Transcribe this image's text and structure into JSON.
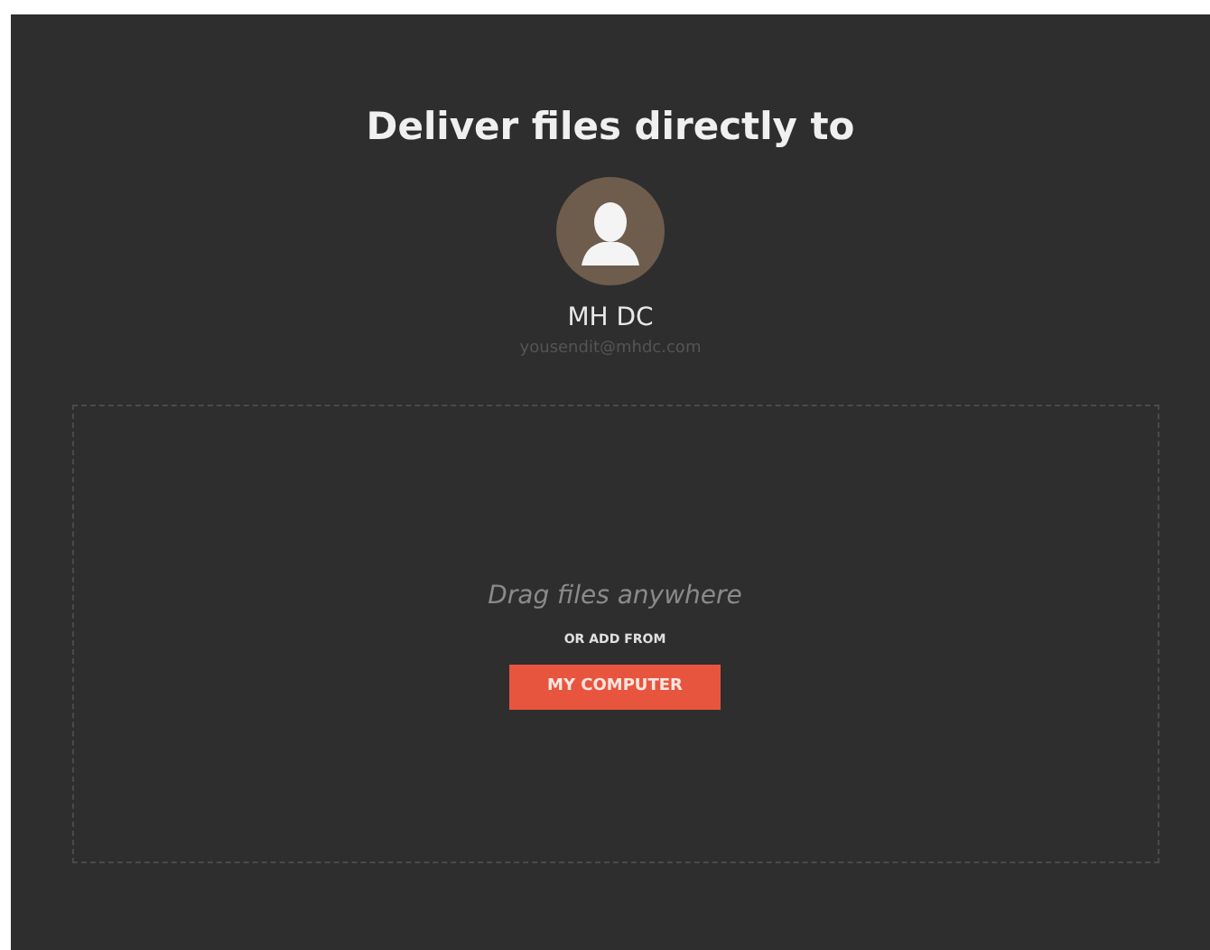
{
  "heading": "Deliver files directly to",
  "recipient": {
    "name": "MH DC",
    "email": "yousendit@mhdc.com"
  },
  "dropzone": {
    "hint": "Drag files anywhere",
    "or_label": "OR ADD FROM",
    "button": "MY COMPUTER"
  }
}
